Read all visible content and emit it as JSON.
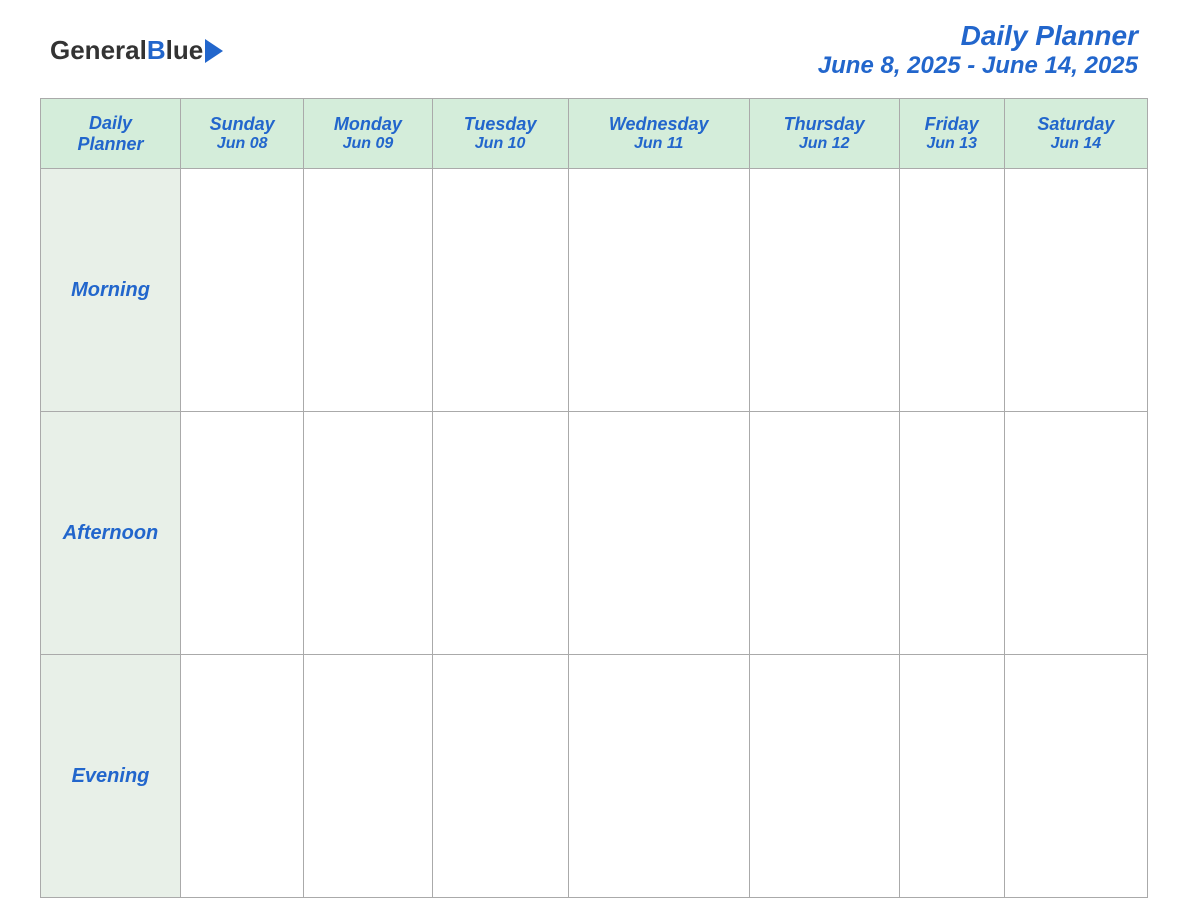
{
  "header": {
    "logo_text_general": "General",
    "logo_text_blue": "Blue",
    "title_main": "Daily Planner",
    "title_dates": "June 8, 2025 - June 14, 2025"
  },
  "table": {
    "corner_line1": "Daily",
    "corner_line2": "Planner",
    "columns": [
      {
        "day": "Sunday",
        "date": "Jun 08"
      },
      {
        "day": "Monday",
        "date": "Jun 09"
      },
      {
        "day": "Tuesday",
        "date": "Jun 10"
      },
      {
        "day": "Wednesday",
        "date": "Jun 11"
      },
      {
        "day": "Thursday",
        "date": "Jun 12"
      },
      {
        "day": "Friday",
        "date": "Jun 13"
      },
      {
        "day": "Saturday",
        "date": "Jun 14"
      }
    ],
    "rows": [
      {
        "label": "Morning"
      },
      {
        "label": "Afternoon"
      },
      {
        "label": "Evening"
      }
    ]
  }
}
